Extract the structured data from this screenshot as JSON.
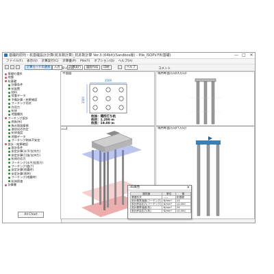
{
  "window": {
    "title": "基礎的原則・杭基礎設計計算(杭本数計算)_杭本数計算 Ver.3 (64bit)(Sandbox版) - Pile_ISOPV.F8(基礎)",
    "minimize": "—",
    "maximize": "□",
    "close": "✕"
  },
  "menu": [
    "ファイル(F)",
    "表示(V)",
    "計算実行(C)",
    "計算書(P)",
    "Pile(Y)",
    "オプション(O)",
    "ヘルプ(H)"
  ],
  "toolbar": {
    "mode_button": "計算モードの選択",
    "input_button": "入力",
    "calc_button": "計算実行",
    "report_button": "図面作成",
    "print_button": "印刷",
    "help_button": "ヘルプ"
  },
  "tree": {
    "items": [
      {
        "label": "基礎の選択",
        "dot": "#e14b4b"
      },
      {
        "label": "地盤",
        "dot": "#e14b4b"
      },
      {
        "label": "杭基礎",
        "dot": "#e14b4b"
      },
      {
        "label": "計算条件",
        "dot": "#3a7a3a"
      },
      {
        "label": "杭配置",
        "dot": "#3a7a3a"
      },
      {
        "label": "材料",
        "dot": "#3a7a3a"
      },
      {
        "label": "荷重データ",
        "dot": "#3a7a3a"
      },
      {
        "label": "予備計算・結果確認",
        "dot": "#3a7a3a"
      },
      {
        "label": "フーチング形状",
        "dot": "#3a7a3a"
      },
      {
        "label": "作用力",
        "dot": "#3a7a3a"
      },
      {
        "label": "杭体",
        "dot": "#3a7a3a"
      },
      {
        "label": "地盤種別",
        "dot": "#3a7a3a"
      },
      {
        "label": "フーチング設計",
        "dot": "#e14b4b"
      },
      {
        "label": "底板(杭)",
        "dot": "#3a7a3a"
      },
      {
        "label": "負の周面摩擦",
        "dot": "#3a7a3a"
      },
      {
        "label": "液状化の判定",
        "dot": "#3a7a3a"
      },
      {
        "label": "杭体強度",
        "dot": "#3a7a3a"
      },
      {
        "label": "地盤データ",
        "dot": "#3a7a3a"
      },
      {
        "label": "フーチング剛体不安定",
        "dot": "#3a7a3a"
      },
      {
        "label": "設計・結果確認",
        "dot": "#e14b4b"
      },
      {
        "label": "設計条件",
        "dot": "#3a7a3a"
      },
      {
        "label": "安定計算(水平/支持力)",
        "dot": "#3a7a3a"
      },
      {
        "label": "安定計算(引抜/支持力)",
        "dot": "#3a7a3a"
      },
      {
        "label": "杭体の応力",
        "dot": "#3a7a3a"
      },
      {
        "label": "フーチング(水平/鉛直力)",
        "dot": "#3a7a3a"
      },
      {
        "label": "フーチング(曲げ)",
        "dot": "#3a7a3a"
      },
      {
        "label": "安定計算(地震時)",
        "dot": "#3a7a3a"
      },
      {
        "label": "安定計算(常時)",
        "dot": "#3a7a3a"
      },
      {
        "label": "フーチング(地震時)",
        "dot": "#3a7a3a"
      },
      {
        "label": "杭体照査",
        "dot": "#3a7a3a"
      },
      {
        "label": "計算書",
        "dot": "#e14b4b"
      }
    ],
    "all_chart_button": "All Chart"
  },
  "panes": {
    "plan": {
      "title": "平面図",
      "width_label": "3500",
      "depth_label": "3500",
      "caption_lines": [
        "杭体：場所打ち杭",
        "杭径：1.200 m",
        "杭長：19.00 m"
      ]
    },
    "top_label": "タイトル",
    "comment_label": "コメント",
    "front_section": {
      "title": "場所断面方向(X方向)"
    },
    "side_section": {
      "title": "場所断面方向(Y方向)"
    },
    "view3d": {
      "button": "3D"
    }
  },
  "properties": {
    "title": "3D属性",
    "headers": [
      "属性値",
      "単位",
      "値"
    ],
    "rows": [
      [
        "基礎形式",
        "-----",
        "杭基礎"
      ],
      [
        "設計基準強度(フーチング)",
        "N/mm²",
        "24"
      ],
      [
        "設計許容応力(フーチング)",
        "N/mm²",
        "10.000"
      ],
      [
        "設計基準強度(杭)",
        "N/mm²",
        "24"
      ],
      [
        "設計許容応力(杭)",
        "N/mm²",
        "10.000"
      ]
    ]
  },
  "colors": {
    "accent_blue": "#2e6db0",
    "soil_red": "#e06a6a",
    "soil_blue": "#6a7fd8",
    "pile_gray": "#8c8c8c",
    "footing_gray": "#bdbdbd"
  }
}
